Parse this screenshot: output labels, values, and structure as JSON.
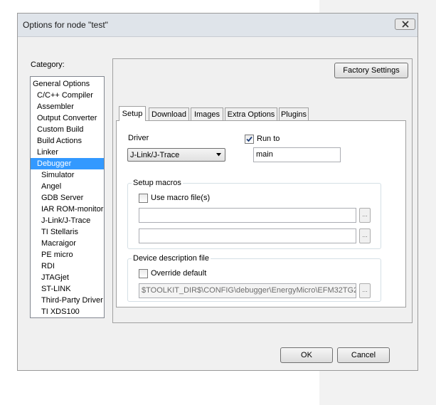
{
  "window": {
    "title": "Options for node \"test\""
  },
  "category": {
    "label": "Category:",
    "items": [
      {
        "label": "General Options"
      },
      {
        "label": "C/C++ Compiler"
      },
      {
        "label": "Assembler"
      },
      {
        "label": "Output Converter"
      },
      {
        "label": "Custom Build"
      },
      {
        "label": "Build Actions"
      },
      {
        "label": "Linker"
      },
      {
        "label": "Debugger"
      },
      {
        "label": "Simulator"
      },
      {
        "label": "Angel"
      },
      {
        "label": "GDB Server"
      },
      {
        "label": "IAR ROM-monitor"
      },
      {
        "label": "J-Link/J-Trace"
      },
      {
        "label": "TI Stellaris"
      },
      {
        "label": "Macraigor"
      },
      {
        "label": "PE micro"
      },
      {
        "label": "RDI"
      },
      {
        "label": "JTAGjet"
      },
      {
        "label": "ST-LINK"
      },
      {
        "label": "Third-Party Driver"
      },
      {
        "label": "TI XDS100"
      }
    ],
    "selected": "Debugger"
  },
  "factory_settings_label": "Factory Settings",
  "tabs": [
    {
      "label": "Setup"
    },
    {
      "label": "Download"
    },
    {
      "label": "Images"
    },
    {
      "label": "Extra Options"
    },
    {
      "label": "Plugins"
    }
  ],
  "setup": {
    "driver_label": "Driver",
    "driver_value": "J-Link/J-Trace",
    "run_to_label": "Run to",
    "run_to_checked": true,
    "run_to_value": "main",
    "setup_macros_label": "Setup macros",
    "use_macro_label": "Use macro file(s)",
    "macro_file_1": "",
    "macro_file_2": "",
    "device_desc_label": "Device description file",
    "override_label": "Override default",
    "device_file_value": "$TOOLKIT_DIR$\\CONFIG\\debugger\\EnergyMicro\\EFM32TG2",
    "browse_label": "..."
  },
  "buttons": {
    "ok": "OK",
    "cancel": "Cancel"
  }
}
